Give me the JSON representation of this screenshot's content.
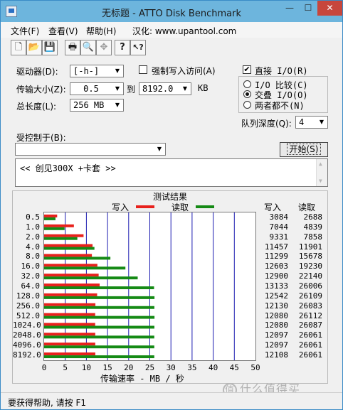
{
  "window": {
    "title": "无标题 - ATTO Disk Benchmark",
    "minimize": "—",
    "maximize": "☐",
    "close": "✕"
  },
  "menu": {
    "items": [
      {
        "label": "文件(F)"
      },
      {
        "label": "查看(V)"
      },
      {
        "label": "帮助(H)"
      },
      {
        "label": "汉化: www.upantool.com"
      }
    ]
  },
  "toolbar": {
    "buttons": [
      {
        "icon": "new-file-icon",
        "glyph": "🗋"
      },
      {
        "icon": "open-folder-icon",
        "glyph": "📂"
      },
      {
        "icon": "save-icon",
        "glyph": "💾"
      },
      {
        "icon": "print-icon",
        "glyph": "🖶"
      },
      {
        "icon": "print-preview-icon",
        "glyph": "🔍"
      },
      {
        "icon": "move-icon",
        "glyph": "✥"
      },
      {
        "icon": "help-icon",
        "glyph": "?"
      },
      {
        "icon": "context-help-icon",
        "glyph": "↖?"
      }
    ]
  },
  "settings": {
    "drive_label": "驱动器(D):",
    "drive_value": "[-h-]",
    "force_write_label": "强制写入访问(A)",
    "force_write_checked": false,
    "transfer_size_label": "传输大小(Z):",
    "transfer_from": "0.5",
    "to_label": "到",
    "transfer_to": "8192.0",
    "kb_label": "KB",
    "total_length_label": "总长度(L):",
    "total_length_value": "256 MB",
    "direct_io_label": "直接 I/O(R)",
    "direct_io_checked": true,
    "io_options": [
      {
        "label": "I/O 比较(C)",
        "selected": false
      },
      {
        "label": "交叠 I/O(O)",
        "selected": true
      },
      {
        "label": "两者都不(N)",
        "selected": false
      }
    ],
    "queue_depth_label": "队列深度(Q):",
    "queue_depth_value": "4",
    "controlled_by_label": "受控制于(B):",
    "controlled_by_value": "",
    "start_button": "开始(S)",
    "description": "<<  创见300X +卡套   >>"
  },
  "results": {
    "title": "测试结果",
    "legend_write": "写入",
    "legend_read": "读取",
    "col_write": "写入",
    "col_read": "读取",
    "xlabel": "传输速率 - MB / 秒",
    "colors": {
      "write": "#e8211c",
      "read": "#158a15",
      "grid": "#1b1bb0"
    }
  },
  "chart_data": {
    "type": "bar",
    "orientation": "horizontal",
    "title": "测试结果",
    "xlabel": "传输速率 - MB / 秒",
    "ylabel": "",
    "xlim": [
      0,
      50
    ],
    "xticks": [
      0,
      5,
      10,
      15,
      20,
      25,
      30,
      35,
      40,
      45,
      50
    ],
    "categories": [
      "0.5",
      "1.0",
      "2.0",
      "4.0",
      "8.0",
      "16.0",
      "32.0",
      "64.0",
      "128.0",
      "256.0",
      "512.0",
      "1024.0",
      "2048.0",
      "4096.0",
      "8192.0"
    ],
    "series": [
      {
        "name": "写入",
        "values": [
          3.084,
          7.044,
          9.331,
          11.457,
          11.299,
          12.603,
          12.9,
          13.133,
          12.542,
          12.13,
          12.08,
          12.08,
          12.097,
          12.097,
          12.108
        ]
      },
      {
        "name": "读取",
        "values": [
          2.688,
          4.839,
          7.858,
          11.901,
          15.678,
          19.23,
          22.14,
          26.006,
          26.109,
          26.083,
          26.112,
          26.087,
          26.061,
          26.061,
          26.061
        ]
      }
    ],
    "write_text": [
      "3084",
      "7044",
      "9331",
      "11457",
      "11299",
      "12603",
      "12900",
      "13133",
      "12542",
      "12130",
      "12080",
      "12080",
      "12097",
      "12097",
      "12108"
    ],
    "read_text": [
      "2688",
      "4839",
      "7858",
      "11901",
      "15678",
      "19230",
      "22140",
      "26006",
      "26109",
      "26083",
      "26112",
      "26087",
      "26061",
      "26061",
      "26061"
    ],
    "grid": true,
    "legend": "top"
  },
  "status": {
    "text": "要获得帮助, 请按 F1"
  },
  "watermark": {
    "glyph": "值",
    "text": "什么值得买"
  }
}
